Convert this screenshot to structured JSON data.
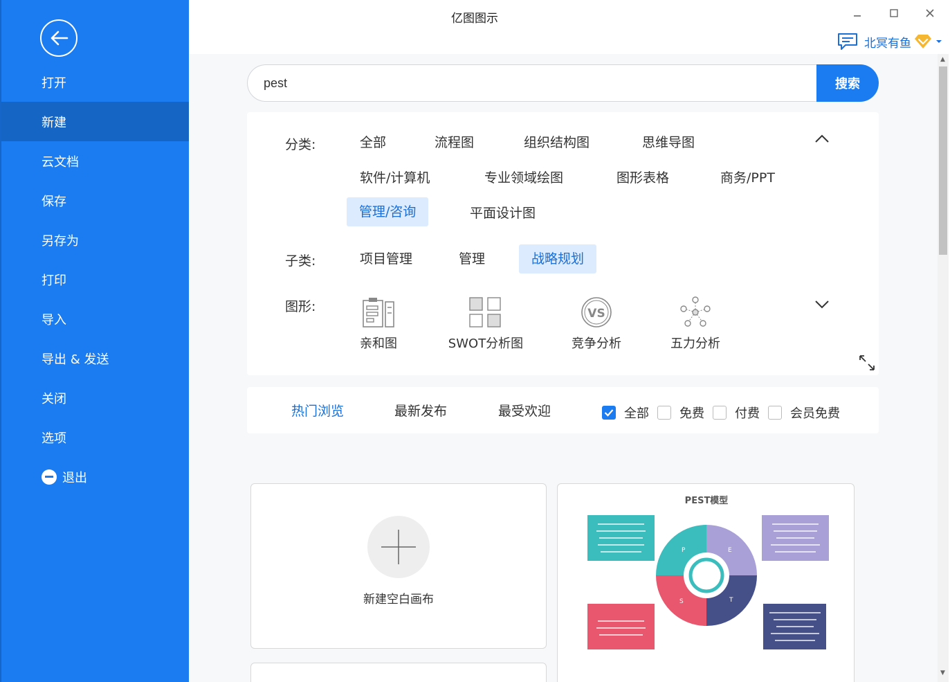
{
  "window": {
    "title": "亿图图示",
    "user_name": "北冥有鱼"
  },
  "sidebar": {
    "items": [
      {
        "label": "打开"
      },
      {
        "label": "新建"
      },
      {
        "label": "云文档"
      },
      {
        "label": "保存"
      },
      {
        "label": "另存为"
      },
      {
        "label": "打印"
      },
      {
        "label": "导入"
      },
      {
        "label": "导出 & 发送"
      },
      {
        "label": "关闭"
      },
      {
        "label": "选项"
      },
      {
        "label": "退出"
      }
    ]
  },
  "search": {
    "value": "pest",
    "button_label": "搜索"
  },
  "filters": {
    "category_label": "分类:",
    "categories": [
      "全部",
      "流程图",
      "组织结构图",
      "思维导图",
      "软件/计算机",
      "专业领域绘图",
      "图形表格",
      "商务/PPT",
      "管理/咨询",
      "平面设计图"
    ],
    "subcategory_label": "子类:",
    "subcategories": [
      "项目管理",
      "管理",
      "战略规划"
    ],
    "shape_label": "图形:",
    "shapes": [
      "亲和图",
      "SWOT分析图",
      "竞争分析",
      "五力分析"
    ]
  },
  "sort": {
    "tabs": [
      "热门浏览",
      "最新发布",
      "最受欢迎"
    ],
    "checks": [
      "全部",
      "免费",
      "付费",
      "会员免费"
    ]
  },
  "templates": {
    "blank_label": "新建空白画布",
    "pest_title": "PEST模型",
    "pest_letters": [
      "P",
      "E",
      "S",
      "T"
    ]
  },
  "colors": {
    "accent": "#1a7cf0",
    "teal": "#3bbdbd",
    "lavender": "#a8a0d6",
    "pink": "#e9576f",
    "navy": "#454f88"
  }
}
